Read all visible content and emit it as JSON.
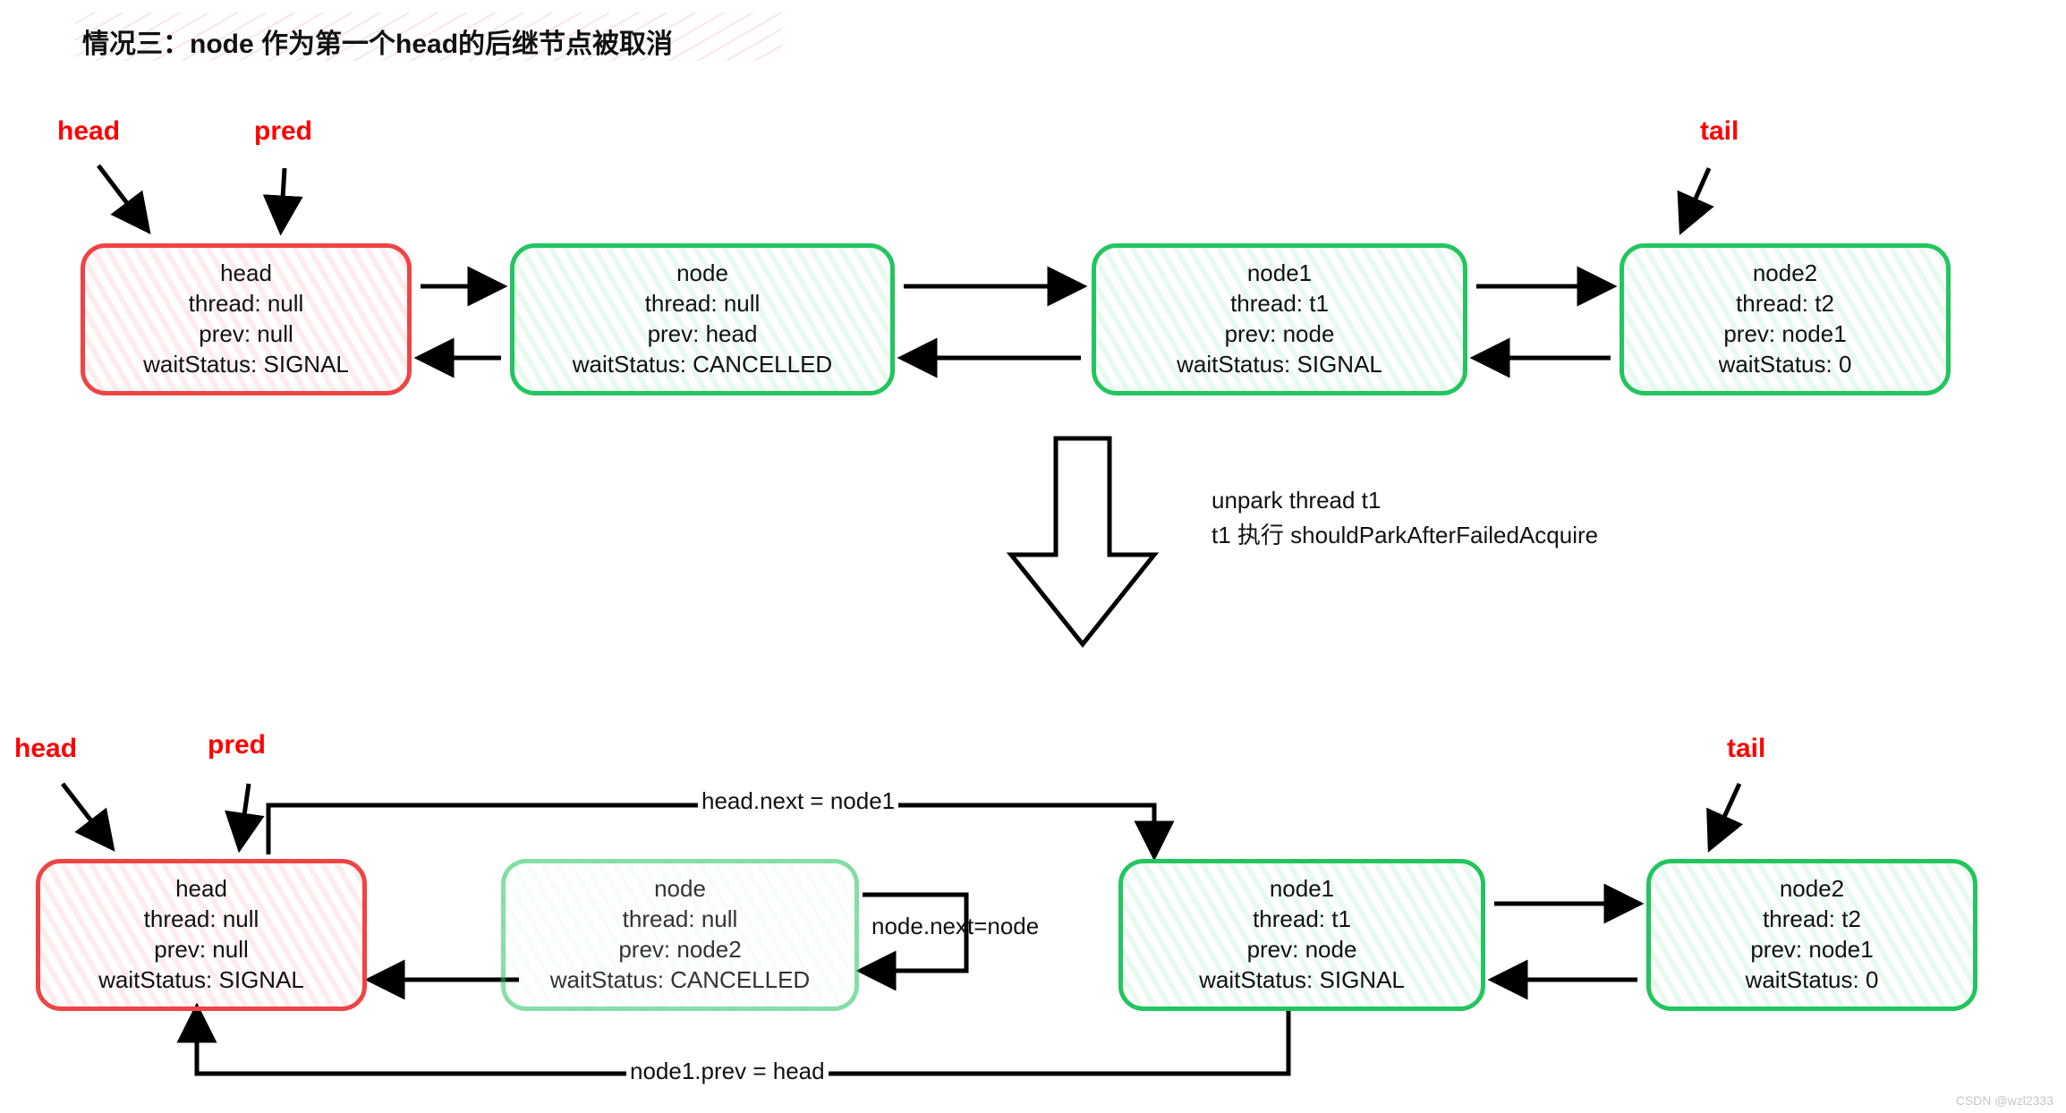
{
  "title": "情况三：node 作为第一个head的后继节点被取消",
  "labels": {
    "head": "head",
    "pred": "pred",
    "tail": "tail"
  },
  "transition": {
    "line1": "unpark thread t1",
    "line2": "t1 执行 shouldParkAfterFailedAcquire"
  },
  "top": {
    "n0": {
      "name": "head",
      "thread": "thread: null",
      "prev": "prev: null",
      "status": "waitStatus: SIGNAL"
    },
    "n1": {
      "name": "node",
      "thread": "thread: null",
      "prev": "prev: head",
      "status": "waitStatus: CANCELLED"
    },
    "n2": {
      "name": "node1",
      "thread": "thread: t1",
      "prev": "prev: node",
      "status": "waitStatus: SIGNAL"
    },
    "n3": {
      "name": "node2",
      "thread": "thread: t2",
      "prev": "prev: node1",
      "status": "waitStatus: 0"
    }
  },
  "bottom": {
    "n0": {
      "name": "head",
      "thread": "thread: null",
      "prev": "prev: null",
      "status": "waitStatus: SIGNAL"
    },
    "n1": {
      "name": "node",
      "thread": "thread: null",
      "prev": "prev: node2",
      "status": "waitStatus: CANCELLED"
    },
    "n2": {
      "name": "node1",
      "thread": "thread: t1",
      "prev": "prev: node",
      "status": "waitStatus: SIGNAL"
    },
    "n3": {
      "name": "node2",
      "thread": "thread: t2",
      "prev": "prev: node1",
      "status": "waitStatus: 0"
    }
  },
  "edgeLabels": {
    "headNext": "head.next = node1",
    "nodeSelf": "node.next=node",
    "node1Prev": "node1.prev = head"
  },
  "watermark": "CSDN @wzl2333"
}
